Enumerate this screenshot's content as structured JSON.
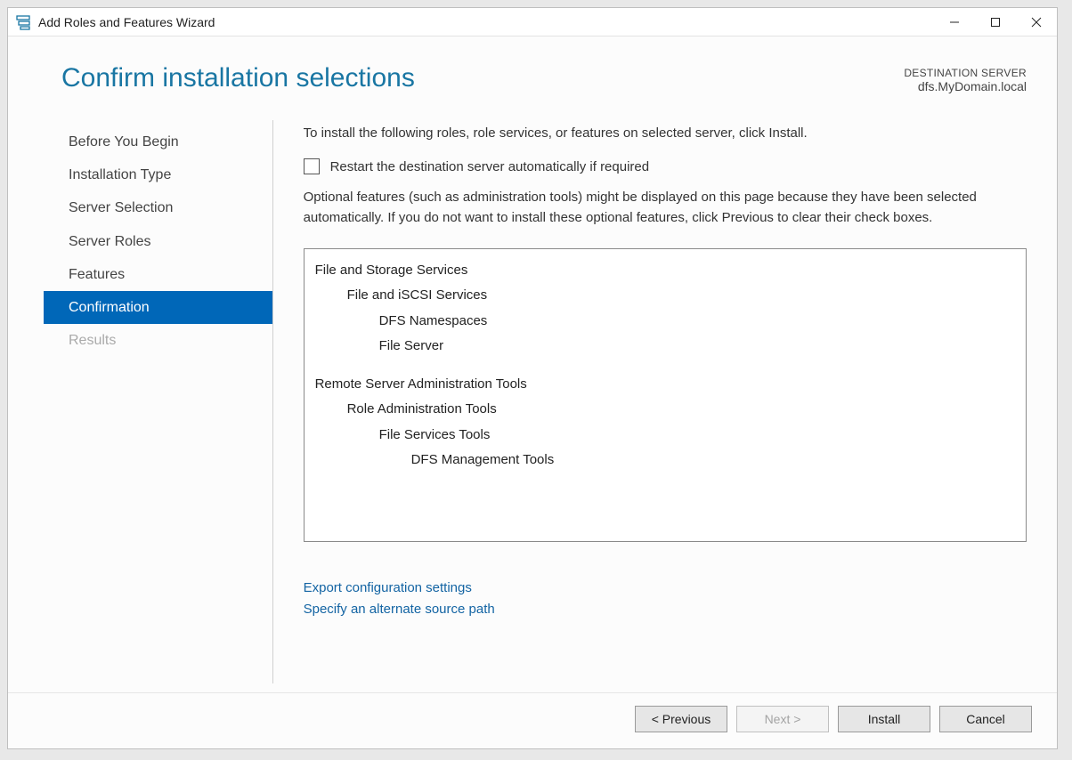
{
  "window": {
    "title": "Add Roles and Features Wizard"
  },
  "header": {
    "page_title": "Confirm installation selections",
    "dest_label": "DESTINATION SERVER",
    "dest_server": "dfs.MyDomain.local"
  },
  "sidebar": {
    "items": [
      {
        "label": "Before You Begin",
        "state": "normal"
      },
      {
        "label": "Installation Type",
        "state": "normal"
      },
      {
        "label": "Server Selection",
        "state": "normal"
      },
      {
        "label": "Server Roles",
        "state": "normal"
      },
      {
        "label": "Features",
        "state": "normal"
      },
      {
        "label": "Confirmation",
        "state": "active"
      },
      {
        "label": "Results",
        "state": "disabled"
      }
    ]
  },
  "main": {
    "intro": "To install the following roles, role services, or features on selected server, click Install.",
    "restart_checked": false,
    "restart_label": "Restart the destination server automatically if required",
    "optional_note": "Optional features (such as administration tools) might be displayed on this page because they have been selected automatically. If you do not want to install these optional features, click Previous to clear their check boxes.",
    "tree": [
      {
        "label": "File and Storage Services",
        "level": 0
      },
      {
        "label": "File and iSCSI Services",
        "level": 1
      },
      {
        "label": "DFS Namespaces",
        "level": 2
      },
      {
        "label": "File Server",
        "level": 2
      },
      {
        "label": "Remote Server Administration Tools",
        "level": 0,
        "gap": true
      },
      {
        "label": "Role Administration Tools",
        "level": 1
      },
      {
        "label": "File Services Tools",
        "level": 2
      },
      {
        "label": "DFS Management Tools",
        "level": 3
      }
    ],
    "links": {
      "export": "Export configuration settings",
      "alt_source": "Specify an alternate source path"
    }
  },
  "footer": {
    "previous": "< Previous",
    "next": "Next >",
    "install": "Install",
    "cancel": "Cancel",
    "next_enabled": false
  }
}
